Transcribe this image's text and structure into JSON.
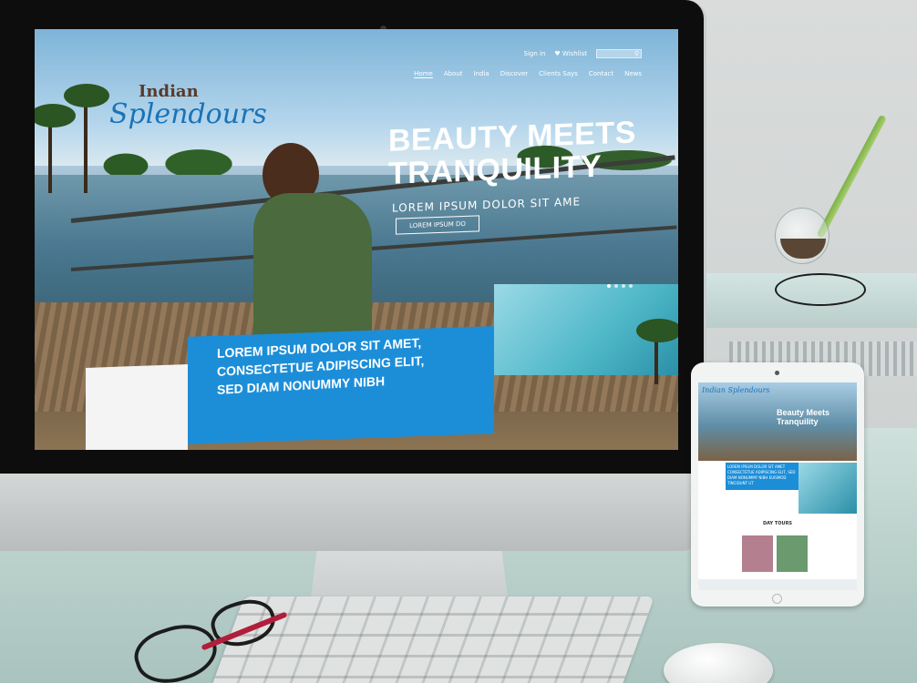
{
  "site": {
    "logo_small": "Indian",
    "logo_big": "Splendours",
    "topbar": {
      "signin": "Sign in",
      "wishlist": "♥ Wishlist",
      "search_icon": "search-icon"
    },
    "nav": [
      "Home",
      "About",
      "India",
      "Discover",
      "Clients Says",
      "Contact",
      "News"
    ],
    "hero": {
      "title_line1": "BEAUTY MEETS",
      "title_line2": "TRANQUILITY",
      "subtitle": "LOREM IPSUM DOLOR SIT AME",
      "button": "LOREM IPSUM DO"
    },
    "banner": {
      "line1": "LOREM IPSUM DOLOR SIT AMET,",
      "line2": "CONSECTETUE ADIPISCING ELIT,",
      "line3": "SED DIAM NONUMMY NIBH"
    }
  },
  "tablet": {
    "logo": "Indian Splendours",
    "title": "Beauty Meets Tranquility",
    "blue_text": "LOREM IPSUM DOLOR SIT AMET CONSECTETUE ADIPISCING ELIT, SED DIAM NONUMMY NIBH EUISMOD TINCIDUNT UT",
    "section": "DAY TOURS"
  },
  "colors": {
    "accent": "#1c8ed8",
    "logo_blue": "#1a73b8"
  }
}
